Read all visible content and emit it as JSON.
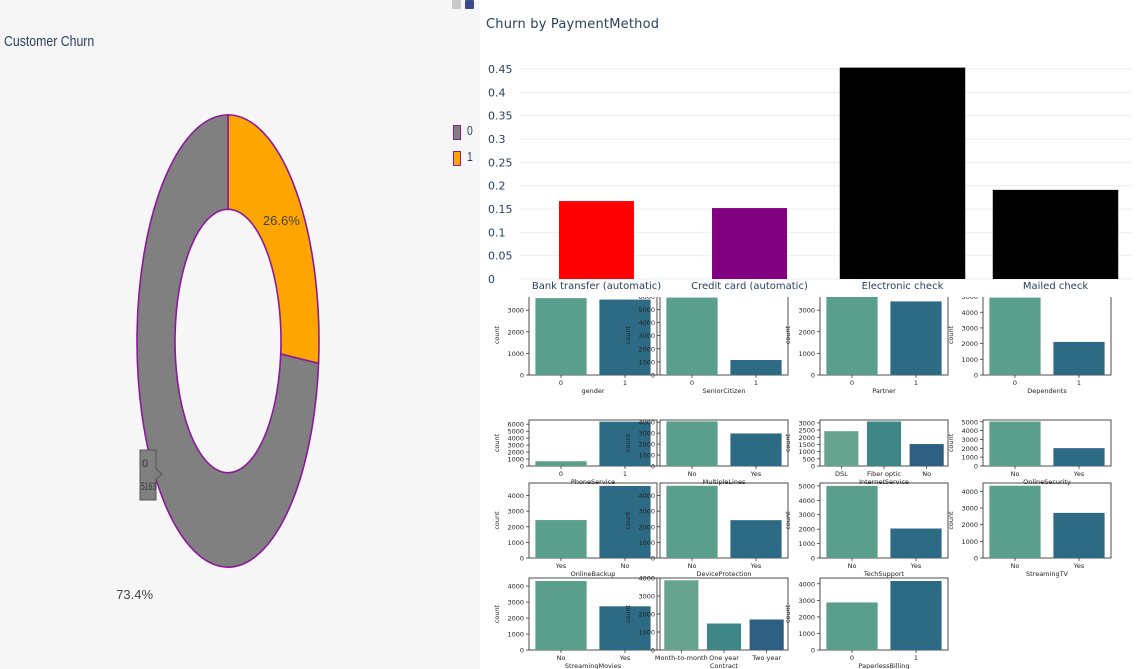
{
  "colors": {
    "slice0": "#808080",
    "slice1": "#ffa500",
    "sliceBorder": "#8b1a9a",
    "barRed": "#ff0000",
    "barPurple": "#800080",
    "barBlack": "#000000",
    "seaborn": [
      "#5a9e8c",
      "#2d6b84"
    ],
    "seaborn3": [
      "#67a48f",
      "#3f8787",
      "#2d5f82"
    ],
    "text": "#2a3f5f"
  },
  "icons": [
    "camera-icon",
    "plotly-logo-icon"
  ],
  "chart_data": [
    {
      "type": "pie",
      "title": "Customer Churn",
      "hole": 0.55,
      "labels": [
        "0",
        "1"
      ],
      "values": [
        5163,
        1869
      ],
      "percent_labels": [
        "73.4%",
        "26.6%"
      ],
      "legend": [
        "0",
        "1"
      ],
      "hover": {
        "label": "0",
        "value": "5163"
      }
    },
    {
      "type": "bar",
      "title": "Churn by PaymentMethod",
      "categories": [
        "Bank transfer (automatic)",
        "Credit card (automatic)",
        "Electronic check",
        "Mailed check"
      ],
      "values": [
        0.167,
        0.152,
        0.453,
        0.191
      ],
      "ylim": [
        0,
        0.48
      ],
      "yticks": [
        "0",
        "0.05",
        "0.1",
        "0.15",
        "0.2",
        "0.25",
        "0.3",
        "0.35",
        "0.4",
        "0.45"
      ],
      "grid": true
    },
    {
      "type": "bar",
      "subplots": [
        {
          "xlabel": "gender",
          "ylabel": "count",
          "categories": [
            "0",
            "1"
          ],
          "values": [
            3555,
            3488
          ],
          "ylim": [
            0,
            3700
          ],
          "yticks": [
            "0",
            "1000",
            "2000",
            "3000"
          ]
        },
        {
          "xlabel": "SeniorCitizen",
          "ylabel": "count",
          "categories": [
            "0",
            "1"
          ],
          "values": [
            5901,
            1142
          ],
          "ylim": [
            0,
            6100
          ],
          "yticks": [
            "0",
            "1000",
            "2000",
            "3000",
            "4000",
            "5000",
            "6000"
          ]
        },
        {
          "xlabel": "Partner",
          "ylabel": "count",
          "categories": [
            "0",
            "1"
          ],
          "values": [
            3641,
            3402
          ],
          "ylim": [
            0,
            3700
          ],
          "yticks": [
            "0",
            "1000",
            "2000",
            "3000"
          ]
        },
        {
          "xlabel": "Dependents",
          "ylabel": "count",
          "categories": [
            "0",
            "1"
          ],
          "values": [
            4933,
            2110
          ],
          "ylim": [
            0,
            5100
          ],
          "yticks": [
            "0",
            "1000",
            "2000",
            "3000",
            "4000",
            "5000"
          ]
        },
        {
          "xlabel": "PhoneService",
          "ylabel": "count",
          "categories": [
            "0",
            "1"
          ],
          "values": [
            682,
            6361
          ],
          "ylim": [
            0,
            6600
          ],
          "yticks": [
            "0",
            "1000",
            "2000",
            "3000",
            "4000",
            "5000",
            "6000"
          ]
        },
        {
          "xlabel": "MultipleLines",
          "ylabel": "count",
          "categories": [
            "No",
            "Yes"
          ],
          "values": [
            4072,
            2971
          ],
          "ylim": [
            0,
            4200
          ],
          "yticks": [
            "0",
            "1000",
            "2000",
            "3000",
            "4000"
          ]
        },
        {
          "xlabel": "InternetService",
          "ylabel": "count",
          "categories": [
            "DSL",
            "Fiber optic",
            "No"
          ],
          "values": [
            2421,
            3096,
            1526
          ],
          "ylim": [
            0,
            3200
          ],
          "yticks": [
            "0",
            "500",
            "1000",
            "1500",
            "2000",
            "2500",
            "3000"
          ]
        },
        {
          "xlabel": "OnlineSecurity",
          "ylabel": "count",
          "categories": [
            "No",
            "Yes"
          ],
          "values": [
            5024,
            2019
          ],
          "ylim": [
            0,
            5200
          ],
          "yticks": [
            "0",
            "1000",
            "2000",
            "3000",
            "4000",
            "5000"
          ]
        },
        {
          "xlabel": "OnlineBackup",
          "ylabel": "count",
          "categories": [
            "Yes",
            "No"
          ],
          "values": [
            2429,
            4614
          ],
          "ylim": [
            0,
            4800
          ],
          "yticks": [
            "0",
            "1000",
            "2000",
            "3000",
            "4000"
          ]
        },
        {
          "xlabel": "DeviceProtection",
          "ylabel": "count",
          "categories": [
            "No",
            "Yes"
          ],
          "values": [
            4621,
            2422
          ],
          "ylim": [
            0,
            4800
          ],
          "yticks": [
            "0",
            "1000",
            "2000",
            "3000",
            "4000"
          ]
        },
        {
          "xlabel": "TechSupport",
          "ylabel": "count",
          "categories": [
            "No",
            "Yes"
          ],
          "values": [
            4999,
            2044
          ],
          "ylim": [
            0,
            5200
          ],
          "yticks": [
            "0",
            "1000",
            "2000",
            "3000",
            "4000",
            "5000"
          ]
        },
        {
          "xlabel": "StreamingTV",
          "ylabel": "count",
          "categories": [
            "No",
            "Yes"
          ],
          "values": [
            4336,
            2707
          ],
          "ylim": [
            0,
            4500
          ],
          "yticks": [
            "0",
            "1000",
            "2000",
            "3000",
            "4000"
          ]
        },
        {
          "xlabel": "StreamingMovies",
          "ylabel": "count",
          "categories": [
            "No",
            "Yes"
          ],
          "values": [
            4311,
            2732
          ],
          "ylim": [
            0,
            4500
          ],
          "yticks": [
            "0",
            "1000",
            "2000",
            "3000",
            "4000"
          ]
        },
        {
          "xlabel": "Contract",
          "ylabel": "count",
          "categories": [
            "Month-to-month",
            "One year",
            "Two year"
          ],
          "values": [
            3875,
            1473,
            1695
          ],
          "ylim": [
            0,
            4000
          ],
          "yticks": [
            "0",
            "1000",
            "2000",
            "3000",
            "4000"
          ]
        },
        {
          "xlabel": "PaperlessBilling",
          "ylabel": "count",
          "categories": [
            "0",
            "1"
          ],
          "values": [
            2872,
            4171
          ],
          "ylim": [
            0,
            4350
          ],
          "yticks": [
            "0",
            "1000",
            "2000",
            "3000",
            "4000"
          ]
        }
      ]
    }
  ]
}
